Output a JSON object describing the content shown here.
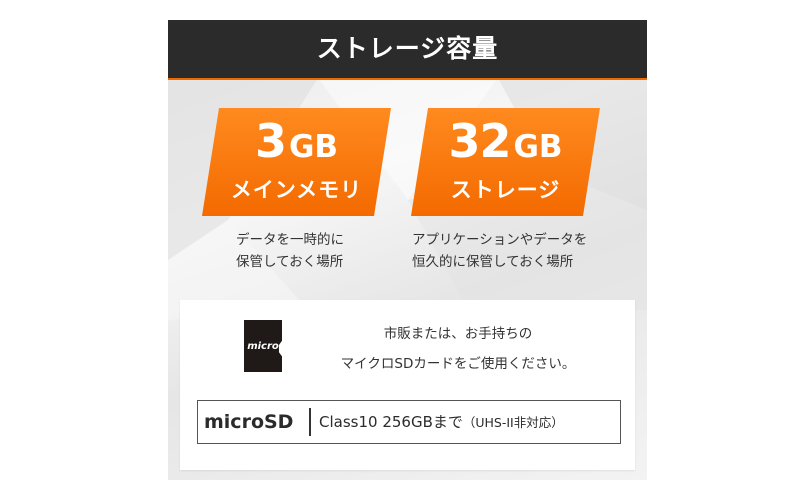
{
  "header": {
    "title": "ストレージ容量"
  },
  "badges": [
    {
      "number": "3",
      "unit": "GB",
      "label": "メインメモリ",
      "desc_lines": [
        "データを一時的に",
        "保管しておく場所"
      ]
    },
    {
      "number": "32",
      "unit": "GB",
      "label": "ストレージ",
      "desc_lines": [
        "アプリケーションやデータを",
        "恒久的に保管しておく場所"
      ]
    }
  ],
  "card": {
    "sd_icon_text": "micro",
    "lines": [
      "市販または、お手持ちの",
      "マイクロSDカードをご使用ください。"
    ],
    "spec": {
      "label": "microSD",
      "main": "Class10 256GBまで",
      "note": "（UHS-II非対応）"
    }
  },
  "colors": {
    "accent": "#f36a00",
    "header_bg": "#2b2b2b"
  }
}
